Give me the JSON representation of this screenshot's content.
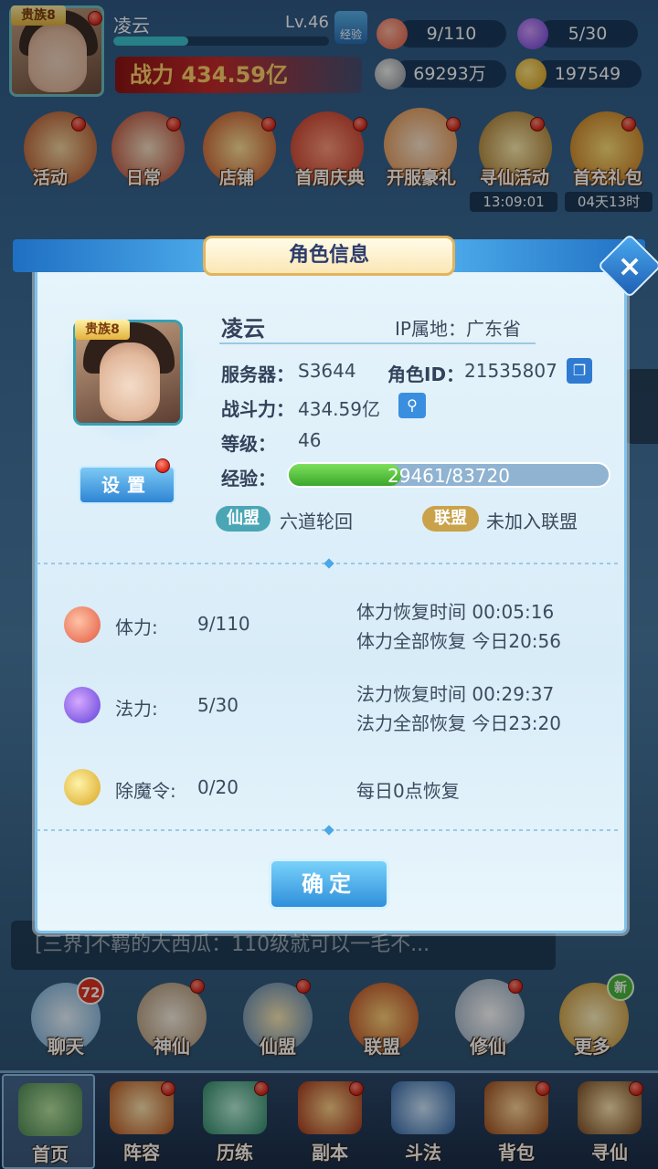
{
  "hud": {
    "vip_label": "贵族8",
    "player_name": "凌云",
    "level": "Lv.46",
    "exp_button": "经验",
    "power_label": "战力 434.59亿",
    "stamina": "9/110",
    "mana": "5/30",
    "silver": "69293万",
    "gold": "197549"
  },
  "activities": [
    {
      "label": "活动",
      "icon": "drum-icon"
    },
    {
      "label": "日常",
      "icon": "scroll-icon"
    },
    {
      "label": "店铺",
      "icon": "shop-icon"
    },
    {
      "label": "首周庆典",
      "icon": "celebration-icon"
    },
    {
      "label": "开服豪礼",
      "icon": "fox-girl-icon"
    },
    {
      "label": "寻仙活动",
      "icon": "seek-immortal-icon",
      "timer": "13:09:01"
    },
    {
      "label": "首充礼包",
      "icon": "gift-bag-icon",
      "timer": "04天13时"
    }
  ],
  "modal": {
    "title": "角色信息",
    "vip_label": "贵族8",
    "name": "凌云",
    "ip_location": "IP属地：广东省",
    "server_label": "服务器：",
    "server_value": "S3644",
    "role_id_label": "角色ID：",
    "role_id_value": "21535807",
    "power_label": "战斗力：",
    "power_value": "434.59亿",
    "level_label": "等级：",
    "level_value": "46",
    "exp_label": "经验：",
    "exp_value": "29461/83720",
    "exp_fraction": 0.352,
    "settings_button": "设置",
    "sect_tag": "仙盟",
    "sect_value": "六道轮回",
    "alliance_tag": "联盟",
    "alliance_value": "未加入联盟",
    "stats": [
      {
        "icon": "peach-icon",
        "label": "体力:",
        "value": "9/110",
        "info1": "体力恢复时间 00:05:16",
        "info2": "体力全部恢复 今日20:56"
      },
      {
        "icon": "flame-icon",
        "label": "法力:",
        "value": "5/30",
        "info1": "法力恢复时间 00:29:37",
        "info2": "法力全部恢复 今日23:20"
      },
      {
        "icon": "demon-token-icon",
        "label": "除魔令:",
        "value": "0/20",
        "info1": "每日0点恢复",
        "info2": ""
      }
    ],
    "ok_button": "确定"
  },
  "chat": {
    "line": "[三界]不羁的大西瓜：110级就可以一毛不..."
  },
  "functions": [
    {
      "label": "聊天",
      "badge": "72"
    },
    {
      "label": "神仙"
    },
    {
      "label": "仙盟"
    },
    {
      "label": "联盟"
    },
    {
      "label": "修仙"
    },
    {
      "label": "更多",
      "badge_new": "新"
    }
  ],
  "nav": [
    {
      "label": "首页"
    },
    {
      "label": "阵容"
    },
    {
      "label": "历练"
    },
    {
      "label": "副本"
    },
    {
      "label": "斗法"
    },
    {
      "label": "背包"
    },
    {
      "label": "寻仙"
    }
  ],
  "colors": {
    "accent_blue": "#2f85d4",
    "power_gold": "#ffd36b",
    "exp_green": "#3ba72b",
    "sect_teal": "#4aa6b4",
    "alliance_gold": "#c9a24a"
  }
}
